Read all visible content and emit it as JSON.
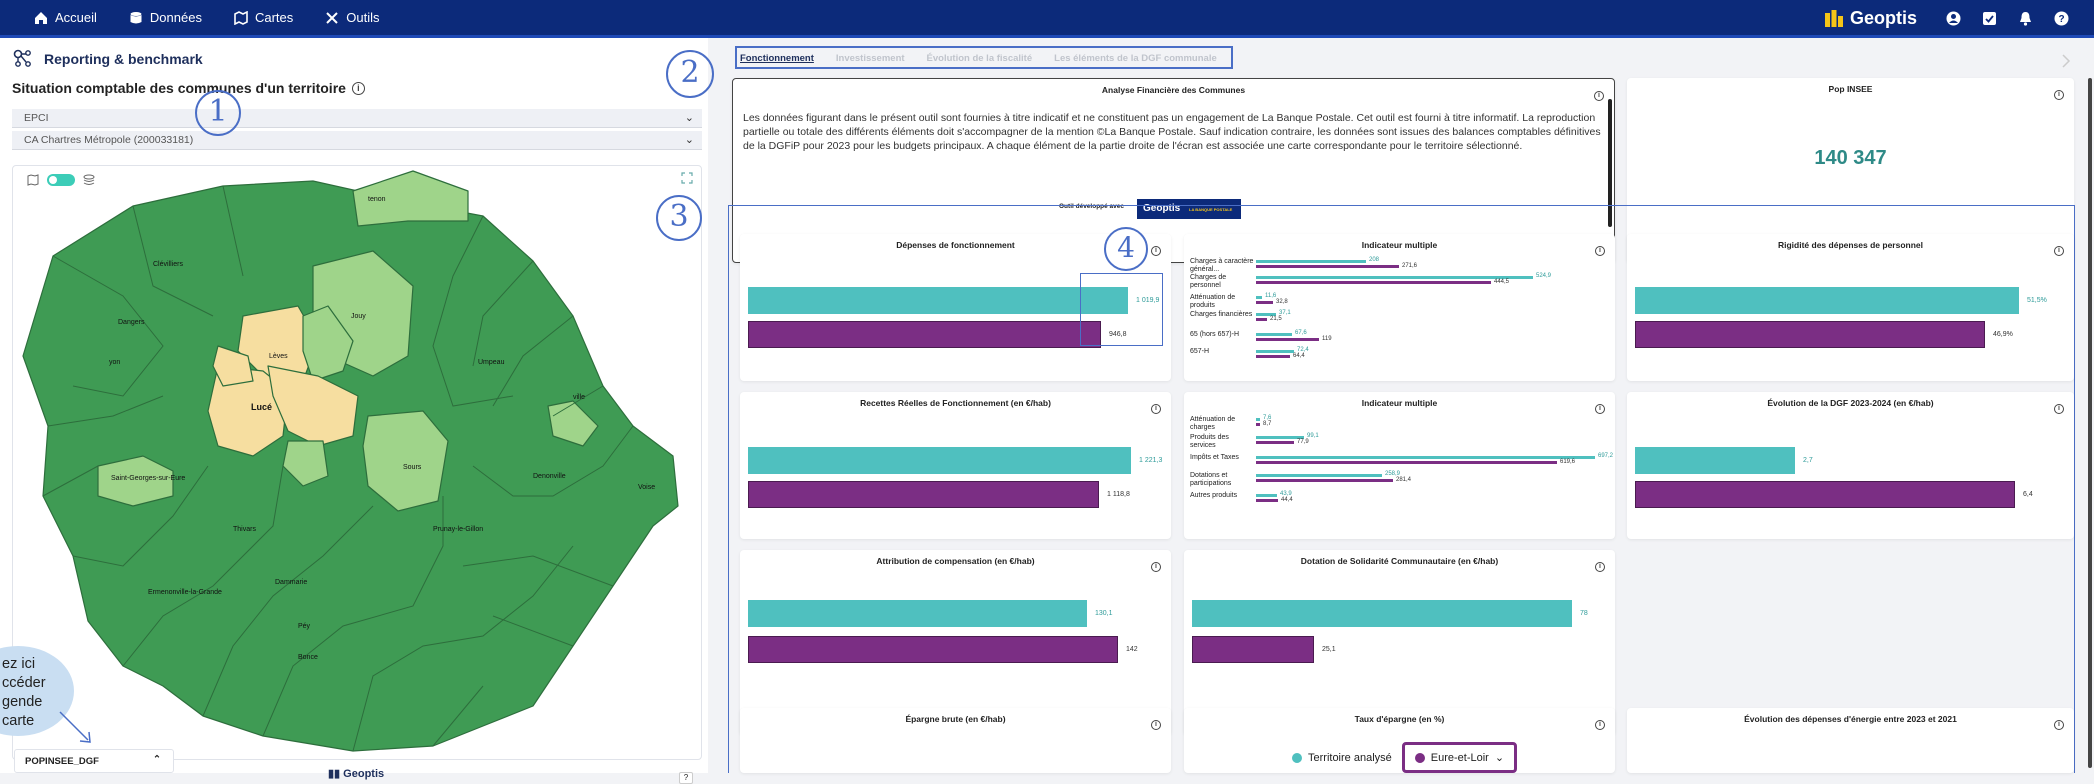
{
  "nav": {
    "items": [
      {
        "label": "Accueil",
        "icon": "home-icon"
      },
      {
        "label": "Données",
        "icon": "database-icon"
      },
      {
        "label": "Cartes",
        "icon": "map-icon"
      },
      {
        "label": "Outils",
        "icon": "tools-icon"
      }
    ],
    "brand": "Geoptis"
  },
  "left": {
    "title": "Reporting & benchmark",
    "subtitle": "Situation comptable des communes d'un territoire",
    "select1": "EPCI",
    "select2": "CA Chartres Métropole (200033181)",
    "map": {
      "communes": [
        "Clévilliers",
        "Dangers",
        "Jouy",
        "Lèves",
        "Umpeau",
        "Lucé",
        "Saint-Georges-sur-Eure",
        "Sours",
        "Thivars",
        "Voise",
        "Denonville",
        "Prunay-le-Gillon",
        "Ermenonville-la-Grande",
        "Dammarie",
        "Bonce",
        "Péy",
        "tenon",
        "yon",
        "ville"
      ],
      "legend_field": "POPINSEE_DGF",
      "logo": "Geoptis",
      "help": "?"
    },
    "bubble": [
      "ez ici",
      "ccéder",
      "gende",
      "carte"
    ]
  },
  "annotations": [
    "1",
    "2",
    "3",
    "4"
  ],
  "tabs": [
    "Fonctionnement",
    "Investissement",
    "Évolution de la fiscalité",
    "Les éléments de la DGF communale"
  ],
  "analyse": {
    "title": "Analyse Financière des Communes",
    "text": "Les données figurant dans le présent outil sont fournies à titre indicatif et ne constituent pas un engagement de La Banque Postale. Cet outil est fourni à titre informatif. La reproduction partielle ou totale des différents éléments doit s'accompagner de la mention ©La Banque Postale. Sauf indication contraire, les données sont issues des balances comptables définitives de la DGFiP pour 2023 pour les budgets principaux. A chaque élément de la partie droite de l'écran est associée une carte correspondante pour le territoire sélectionné.",
    "dev_label": "Outil développé avec",
    "geoptis": "Geoptis",
    "lbp": "LA BANQUE POSTALE"
  },
  "pop": {
    "title": "Pop INSEE",
    "value": "140 347"
  },
  "colors": {
    "teal": "#4fc0bf",
    "purple": "#7b2e84",
    "nav": "#0c2a7a",
    "map_dark": "#3f9b54",
    "map_light": "#9fd48a",
    "map_pale": "#f6dea0"
  },
  "cards": {
    "depenses": {
      "title": "Dépenses de fonctionnement",
      "a": "1 019,9",
      "b": "946,8",
      "av": 1019.9,
      "bv": 946.8,
      "max": 1060
    },
    "indic1": {
      "title": "Indicateur multiple",
      "rows": [
        {
          "label": "Charges à caractère général...",
          "a": "208",
          "b": "271,6",
          "av": 208,
          "bv": 271.6
        },
        {
          "label": "Charges de personnel",
          "a": "524,9",
          "b": "444,5",
          "av": 524.9,
          "bv": 444.5
        },
        {
          "label": "Atténuation de produits",
          "a": "11,6",
          "b": "32,8",
          "av": 11.6,
          "bv": 32.8
        },
        {
          "label": "Charges financières",
          "a": "37,1",
          "b": "21,5",
          "av": 37.1,
          "bv": 21.5
        },
        {
          "label": "65 (hors 657)-H",
          "a": "67,6",
          "b": "119",
          "av": 67.6,
          "bv": 119
        },
        {
          "label": "657-H",
          "a": "72,4",
          "b": "64,4",
          "av": 72.4,
          "bv": 64.4
        }
      ],
      "max": 530
    },
    "rigidite": {
      "title": "Rigidité des dépenses de personnel",
      "a": "51,5%",
      "b": "46,9%",
      "av": 51.5,
      "bv": 46.9,
      "max": 53
    },
    "recettes": {
      "title": "Recettes Réelles de Fonctionnement (en €/hab)",
      "a": "1 221,3",
      "b": "1 118,8",
      "av": 1221.3,
      "bv": 1118.8,
      "max": 1260
    },
    "indic2": {
      "title": "Indicateur multiple",
      "rows": [
        {
          "label": "Atténuation de charges",
          "a": "7,6",
          "b": "8,7",
          "av": 7.6,
          "bv": 8.7
        },
        {
          "label": "Produits des services",
          "a": "99,1",
          "b": "77,9",
          "av": 99.1,
          "bv": 77.9
        },
        {
          "label": "Impôts et Taxes",
          "a": "697,2",
          "b": "619,6",
          "av": 697.2,
          "bv": 619.6
        },
        {
          "label": "Dotations et participations",
          "a": "258,9",
          "b": "281,4",
          "av": 258.9,
          "bv": 281.4
        },
        {
          "label": "Autres produits",
          "a": "43,9",
          "b": "44,4",
          "av": 43.9,
          "bv": 44.4
        }
      ],
      "max": 700
    },
    "dgf": {
      "title": "Évolution de la DGF 2023-2024 (en €/hab)",
      "a": "2,7",
      "b": "6,4",
      "av": 2.7,
      "bv": 6.4,
      "max": 6.6
    },
    "attribution": {
      "title": "Attribution de compensation (en €/hab)",
      "a": "130,1",
      "b": "142",
      "av": 130.1,
      "bv": 142,
      "max": 146
    },
    "dsc": {
      "title": "Dotation de Solidarité Communautaire (en €/hab)",
      "a": "78",
      "b": "25,1",
      "av": 78,
      "bv": 25.1,
      "max": 80
    },
    "epargne": {
      "title": "Épargne brute (en €/hab)"
    },
    "taux": {
      "title": "Taux d'épargne (en %)"
    },
    "energie": {
      "title": "Évolution des dépenses d'énergie entre 2023 et 2021"
    }
  },
  "legend": {
    "a": "Territoire analysé",
    "b": "Eure-et-Loir"
  }
}
